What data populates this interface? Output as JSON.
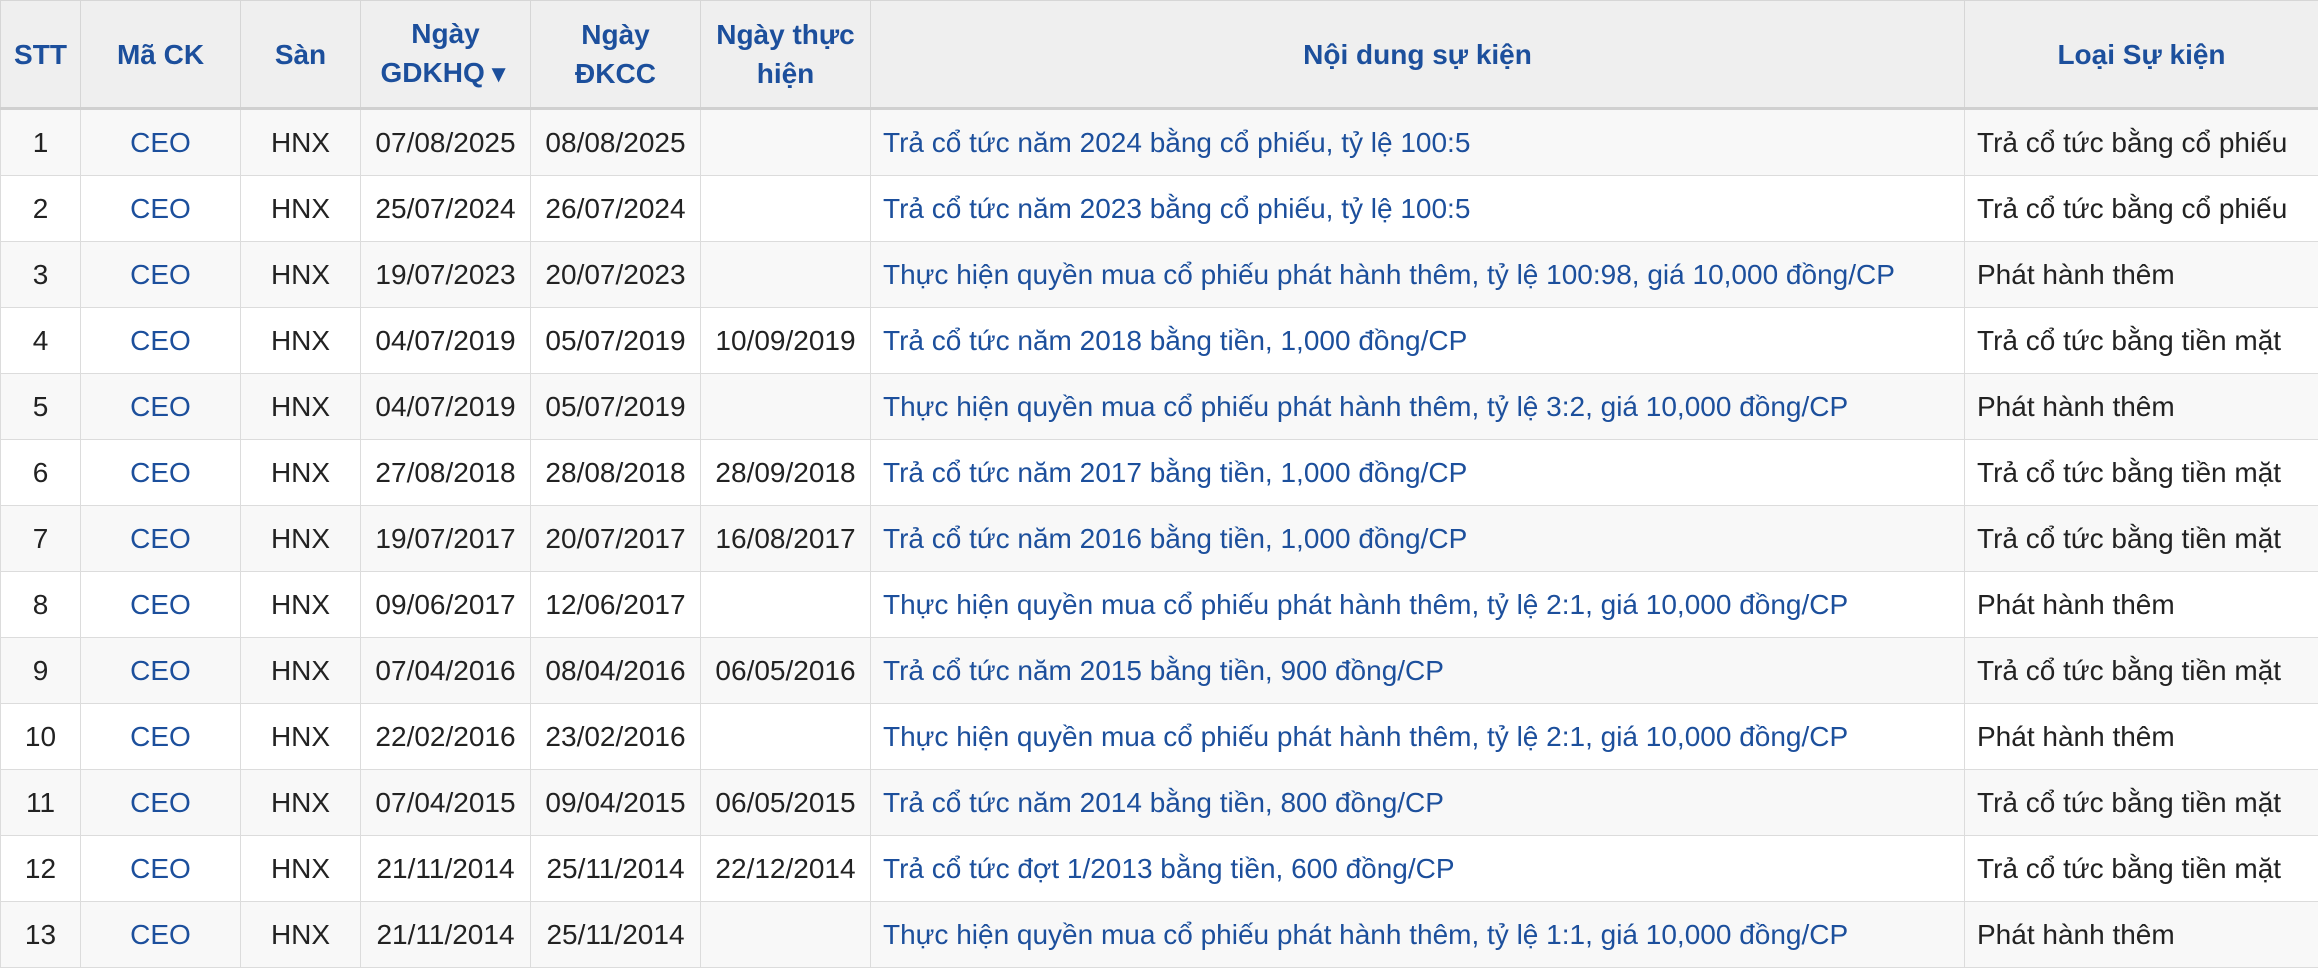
{
  "table": {
    "headers": {
      "stt": "STT",
      "ma_ck": "Mã CK",
      "san": "Sàn",
      "ngay_gdkhq_line1": "Ngày",
      "ngay_gdkhq_line2": "GDKHQ",
      "sort_icon": "▼",
      "ngay_dkcc_line1": "Ngày",
      "ngay_dkcc_line2": "ĐKCC",
      "ngay_thuc_hien_line1": "Ngày thực",
      "ngay_thuc_hien_line2": "hiện",
      "noi_dung": "Nội dung sự kiện",
      "loai": "Loại Sự kiện"
    },
    "rows": [
      {
        "stt": "1",
        "ma_ck": "CEO",
        "san": "HNX",
        "gdkhq": "07/08/2025",
        "dkcc": "08/08/2025",
        "thuc_hien": "",
        "noi_dung": "Trả cổ tức năm 2024 bằng cổ phiếu, tỷ lệ 100:5",
        "loai": "Trả cổ tức bằng cổ phiếu"
      },
      {
        "stt": "2",
        "ma_ck": "CEO",
        "san": "HNX",
        "gdkhq": "25/07/2024",
        "dkcc": "26/07/2024",
        "thuc_hien": "",
        "noi_dung": "Trả cổ tức năm 2023 bằng cổ phiếu, tỷ lệ 100:5",
        "loai": "Trả cổ tức bằng cổ phiếu"
      },
      {
        "stt": "3",
        "ma_ck": "CEO",
        "san": "HNX",
        "gdkhq": "19/07/2023",
        "dkcc": "20/07/2023",
        "thuc_hien": "",
        "noi_dung": "Thực hiện quyền mua cổ phiếu phát hành thêm, tỷ lệ 100:98, giá 10,000 đồng/CP",
        "loai": "Phát hành thêm"
      },
      {
        "stt": "4",
        "ma_ck": "CEO",
        "san": "HNX",
        "gdkhq": "04/07/2019",
        "dkcc": "05/07/2019",
        "thuc_hien": "10/09/2019",
        "noi_dung": "Trả cổ tức năm 2018 bằng tiền, 1,000 đồng/CP",
        "loai": "Trả cổ tức bằng tiền mặt"
      },
      {
        "stt": "5",
        "ma_ck": "CEO",
        "san": "HNX",
        "gdkhq": "04/07/2019",
        "dkcc": "05/07/2019",
        "thuc_hien": "",
        "noi_dung": "Thực hiện quyền mua cổ phiếu phát hành thêm, tỷ lệ 3:2, giá 10,000 đồng/CP",
        "loai": "Phát hành thêm"
      },
      {
        "stt": "6",
        "ma_ck": "CEO",
        "san": "HNX",
        "gdkhq": "27/08/2018",
        "dkcc": "28/08/2018",
        "thuc_hien": "28/09/2018",
        "noi_dung": "Trả cổ tức năm 2017 bằng tiền, 1,000 đồng/CP",
        "loai": "Trả cổ tức bằng tiền mặt"
      },
      {
        "stt": "7",
        "ma_ck": "CEO",
        "san": "HNX",
        "gdkhq": "19/07/2017",
        "dkcc": "20/07/2017",
        "thuc_hien": "16/08/2017",
        "noi_dung": "Trả cổ tức năm 2016 bằng tiền, 1,000 đồng/CP",
        "loai": "Trả cổ tức bằng tiền mặt"
      },
      {
        "stt": "8",
        "ma_ck": "CEO",
        "san": "HNX",
        "gdkhq": "09/06/2017",
        "dkcc": "12/06/2017",
        "thuc_hien": "",
        "noi_dung": "Thực hiện quyền mua cổ phiếu phát hành thêm, tỷ lệ 2:1, giá 10,000 đồng/CP",
        "loai": "Phát hành thêm"
      },
      {
        "stt": "9",
        "ma_ck": "CEO",
        "san": "HNX",
        "gdkhq": "07/04/2016",
        "dkcc": "08/04/2016",
        "thuc_hien": "06/05/2016",
        "noi_dung": "Trả cổ tức năm 2015 bằng tiền, 900 đồng/CP",
        "loai": "Trả cổ tức bằng tiền mặt"
      },
      {
        "stt": "10",
        "ma_ck": "CEO",
        "san": "HNX",
        "gdkhq": "22/02/2016",
        "dkcc": "23/02/2016",
        "thuc_hien": "",
        "noi_dung": "Thực hiện quyền mua cổ phiếu phát hành thêm, tỷ lệ 2:1, giá 10,000 đồng/CP",
        "loai": "Phát hành thêm"
      },
      {
        "stt": "11",
        "ma_ck": "CEO",
        "san": "HNX",
        "gdkhq": "07/04/2015",
        "dkcc": "09/04/2015",
        "thuc_hien": "06/05/2015",
        "noi_dung": "Trả cổ tức năm 2014 bằng tiền, 800 đồng/CP",
        "loai": "Trả cổ tức bằng tiền mặt"
      },
      {
        "stt": "12",
        "ma_ck": "CEO",
        "san": "HNX",
        "gdkhq": "21/11/2014",
        "dkcc": "25/11/2014",
        "thuc_hien": "22/12/2014",
        "noi_dung": "Trả cổ tức đợt 1/2013 bằng tiền, 600 đồng/CP",
        "loai": "Trả cổ tức bằng tiền mặt"
      },
      {
        "stt": "13",
        "ma_ck": "CEO",
        "san": "HNX",
        "gdkhq": "21/11/2014",
        "dkcc": "25/11/2014",
        "thuc_hien": "",
        "noi_dung": "Thực hiện quyền mua cổ phiếu phát hành thêm, tỷ lệ 1:1, giá 10,000 đồng/CP",
        "loai": "Phát hành thêm"
      }
    ]
  },
  "colors": {
    "header_bg": "#efefef",
    "header_text": "#1c4f9c",
    "link": "#1c4f9c",
    "body_text": "#222222",
    "row_alt": "#f8f8f8"
  },
  "icons": {
    "sort": "sort-descending-icon"
  }
}
